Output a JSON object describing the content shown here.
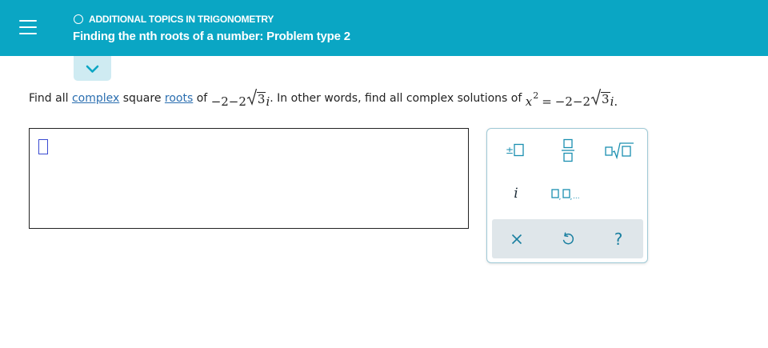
{
  "header": {
    "topic": "ADDITIONAL TOPICS IN TRIGONOMETRY",
    "title": "Finding the nth roots of a number: Problem type 2"
  },
  "question": {
    "find_all": "Find all",
    "link_complex": "complex",
    "square": "square",
    "link_roots": "roots",
    "of": "of",
    "expr_prefix": "−2−2",
    "radicand": "3",
    "imag_unit": "i",
    "middle_text": ". In other words, find all complex solutions of",
    "var": "x",
    "exponent": "2",
    "equals": "=",
    "end_period": "."
  },
  "answer": {
    "value": ""
  },
  "palette": {
    "plus_minus": "±",
    "imaginary": "i",
    "list_ellipsis": "...",
    "clear": "×",
    "undo": "undo",
    "help": "?"
  },
  "colors": {
    "header_bg": "#0aa6c4",
    "accent": "#0aa6c4",
    "link": "#2a6eb0",
    "palette_bottom_bg": "#dfe6ea"
  }
}
